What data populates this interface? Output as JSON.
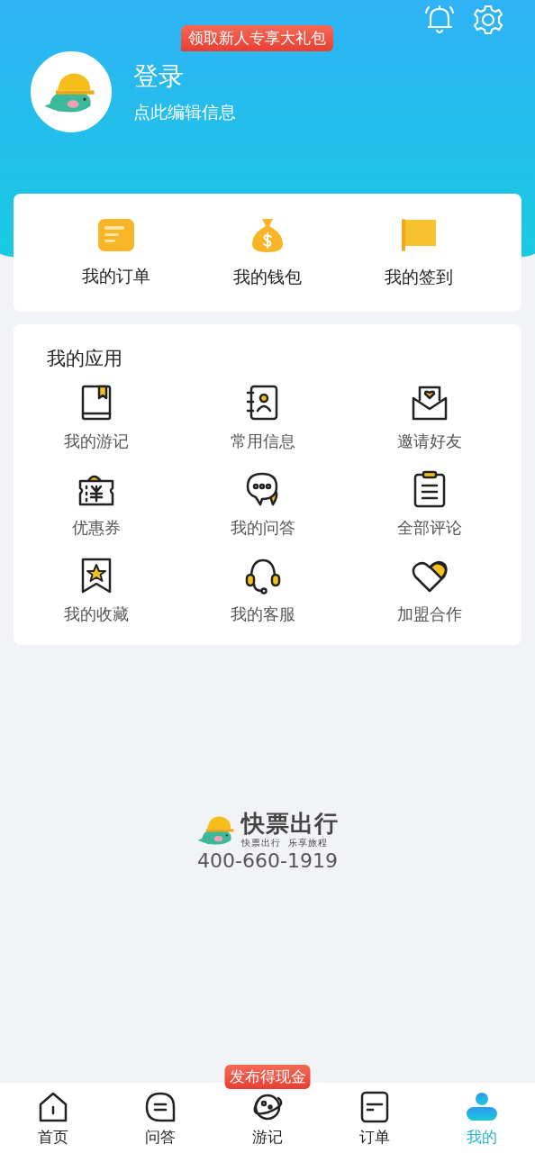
{
  "header": {
    "promo_badge": "领取新人专享大礼包",
    "login": "登录",
    "edit_hint": "点此编辑信息"
  },
  "quick_links": [
    {
      "label": "我的订单"
    },
    {
      "label": "我的钱包"
    },
    {
      "label": "我的签到"
    }
  ],
  "apps": {
    "title": "我的应用",
    "items": [
      {
        "label": "我的游记"
      },
      {
        "label": "常用信息"
      },
      {
        "label": "邀请好友"
      },
      {
        "label": "优惠券"
      },
      {
        "label": "我的问答"
      },
      {
        "label": "全部评论"
      },
      {
        "label": "我的收藏"
      },
      {
        "label": "我的客服"
      },
      {
        "label": "加盟合作"
      }
    ]
  },
  "brand": {
    "name": "快票出行",
    "slogan": "快票出行  乐享旅程",
    "phone": "400-660-1919"
  },
  "tab_bar": {
    "badge": "发布得现金",
    "tabs": [
      {
        "label": "首页",
        "selected": false
      },
      {
        "label": "问答",
        "selected": false
      },
      {
        "label": "游记",
        "selected": false
      },
      {
        "label": "订单",
        "selected": false
      },
      {
        "label": "我的",
        "selected": true
      }
    ]
  }
}
